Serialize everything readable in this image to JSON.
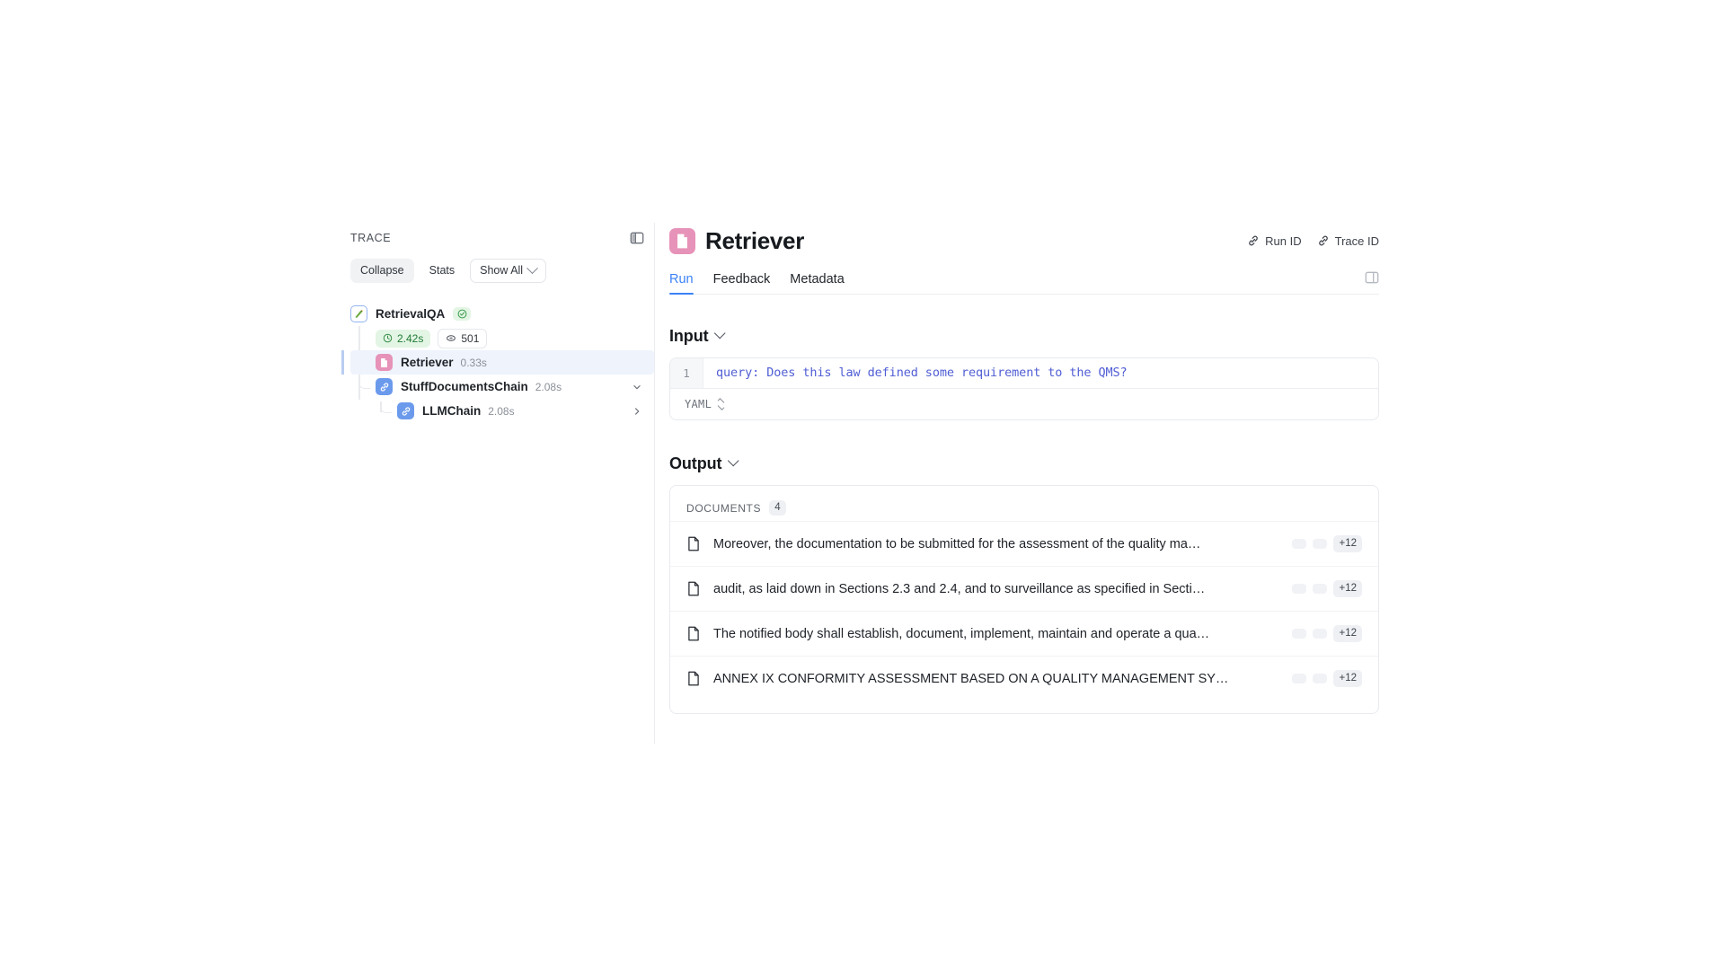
{
  "sidebar": {
    "label": "TRACE",
    "panel_toggle_icon": "panel-left-icon",
    "controls": [
      {
        "label": "Collapse",
        "style": "filled"
      },
      {
        "label": "Stats",
        "style": "plain"
      },
      {
        "label": "Show All",
        "style": "outlined"
      }
    ],
    "tree": [
      {
        "name": "RetrievalQA",
        "icon": "langchain-parrot-icon",
        "status": "success",
        "duration": "2.42s",
        "tokens": "501",
        "depth": 0,
        "selected": false,
        "chevron": ""
      },
      {
        "name": "Retriever",
        "icon": "document-icon",
        "duration": "0.33s",
        "depth": 1,
        "selected": true,
        "chevron": ""
      },
      {
        "name": "StuffDocumentsChain",
        "icon": "chain-link-icon",
        "duration": "2.08s",
        "depth": 1,
        "selected": false,
        "chevron": "down"
      },
      {
        "name": "LLMChain",
        "icon": "chain-link-icon",
        "duration": "2.08s",
        "depth": 2,
        "selected": false,
        "chevron": "right"
      }
    ]
  },
  "header": {
    "icon": "document-icon",
    "title": "Retriever",
    "actions": [
      {
        "label": "Run ID",
        "icon": "link-icon"
      },
      {
        "label": "Trace ID",
        "icon": "link-icon"
      }
    ]
  },
  "tabs": {
    "items": [
      {
        "label": "Run",
        "active": true
      },
      {
        "label": "Feedback",
        "active": false
      },
      {
        "label": "Metadata",
        "active": false
      }
    ],
    "panel_toggle_icon": "panel-right-icon"
  },
  "input": {
    "title": "Input",
    "line_number": "1",
    "code": "query: Does this law defined some requirement to the QMS?",
    "format": "YAML"
  },
  "output": {
    "title": "Output",
    "documents_label": "DOCUMENTS",
    "documents_count": "4",
    "documents": [
      {
        "text": "Moreover, the documentation to be submitted for the assessment of the quality ma…",
        "badge": "+12"
      },
      {
        "text": "audit, as laid down in Sections 2.3 and 2.4, and to surveillance as specified in Secti…",
        "badge": "+12"
      },
      {
        "text": "The notified body shall establish, document, implement, maintain and operate a qua…",
        "badge": "+12"
      },
      {
        "text": "ANNEX IX CONFORMITY ASSESSMENT BASED ON A QUALITY MANAGEMENT SY…",
        "badge": "+12"
      }
    ]
  },
  "colors": {
    "accent": "#3b82f6",
    "retriever_pink": "#e792b8",
    "chain_blue": "#6b9aec",
    "code_purple": "#4f5dd4",
    "success_green": "#1f7a35"
  }
}
